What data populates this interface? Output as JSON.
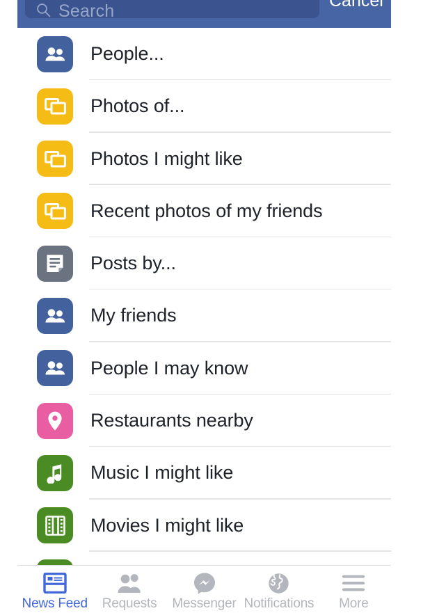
{
  "header": {
    "search_placeholder": "Search",
    "search_value": "",
    "search_icon": "search-icon",
    "cancel_label": "Cancel",
    "bar_color": "#4764a5",
    "field_color": "#3b5490"
  },
  "suggestions": [
    {
      "label": "People...",
      "icon": "people-icon",
      "icon_color": "#43619c"
    },
    {
      "label": "Photos of...",
      "icon": "photos-icon",
      "icon_color": "#f5bc16"
    },
    {
      "label": "Photos I might like",
      "icon": "photos-icon",
      "icon_color": "#f5bc16"
    },
    {
      "label": "Recent photos of my friends",
      "icon": "photos-icon",
      "icon_color": "#f5bc16"
    },
    {
      "label": "Posts by...",
      "icon": "post-icon",
      "icon_color": "#6b7280"
    },
    {
      "label": "My friends",
      "icon": "people-icon",
      "icon_color": "#43619c"
    },
    {
      "label": "People I may know",
      "icon": "people-icon",
      "icon_color": "#43619c"
    },
    {
      "label": "Restaurants nearby",
      "icon": "location-pin-icon",
      "icon_color": "#e95da2"
    },
    {
      "label": "Music I might like",
      "icon": "music-note-icon",
      "icon_color": "#4b8b24"
    },
    {
      "label": "Movies I might like",
      "icon": "film-strip-icon",
      "icon_color": "#4b8b24"
    },
    {
      "label": "",
      "icon": "partial-icon",
      "icon_color": "#4b8b24"
    }
  ],
  "tabs": [
    {
      "label": "News Feed",
      "icon": "news-feed-icon",
      "active": true
    },
    {
      "label": "Requests",
      "icon": "friend-requests-icon",
      "active": false
    },
    {
      "label": "Messenger",
      "icon": "messenger-icon",
      "active": false
    },
    {
      "label": "Notifications",
      "icon": "globe-icon",
      "active": false
    },
    {
      "label": "More",
      "icon": "hamburger-icon",
      "active": false
    }
  ],
  "colors": {
    "accent": "#4267d8",
    "tab_inactive": "#b3b6bc",
    "text": "#1d2129",
    "separator": "#e4e4e4"
  }
}
